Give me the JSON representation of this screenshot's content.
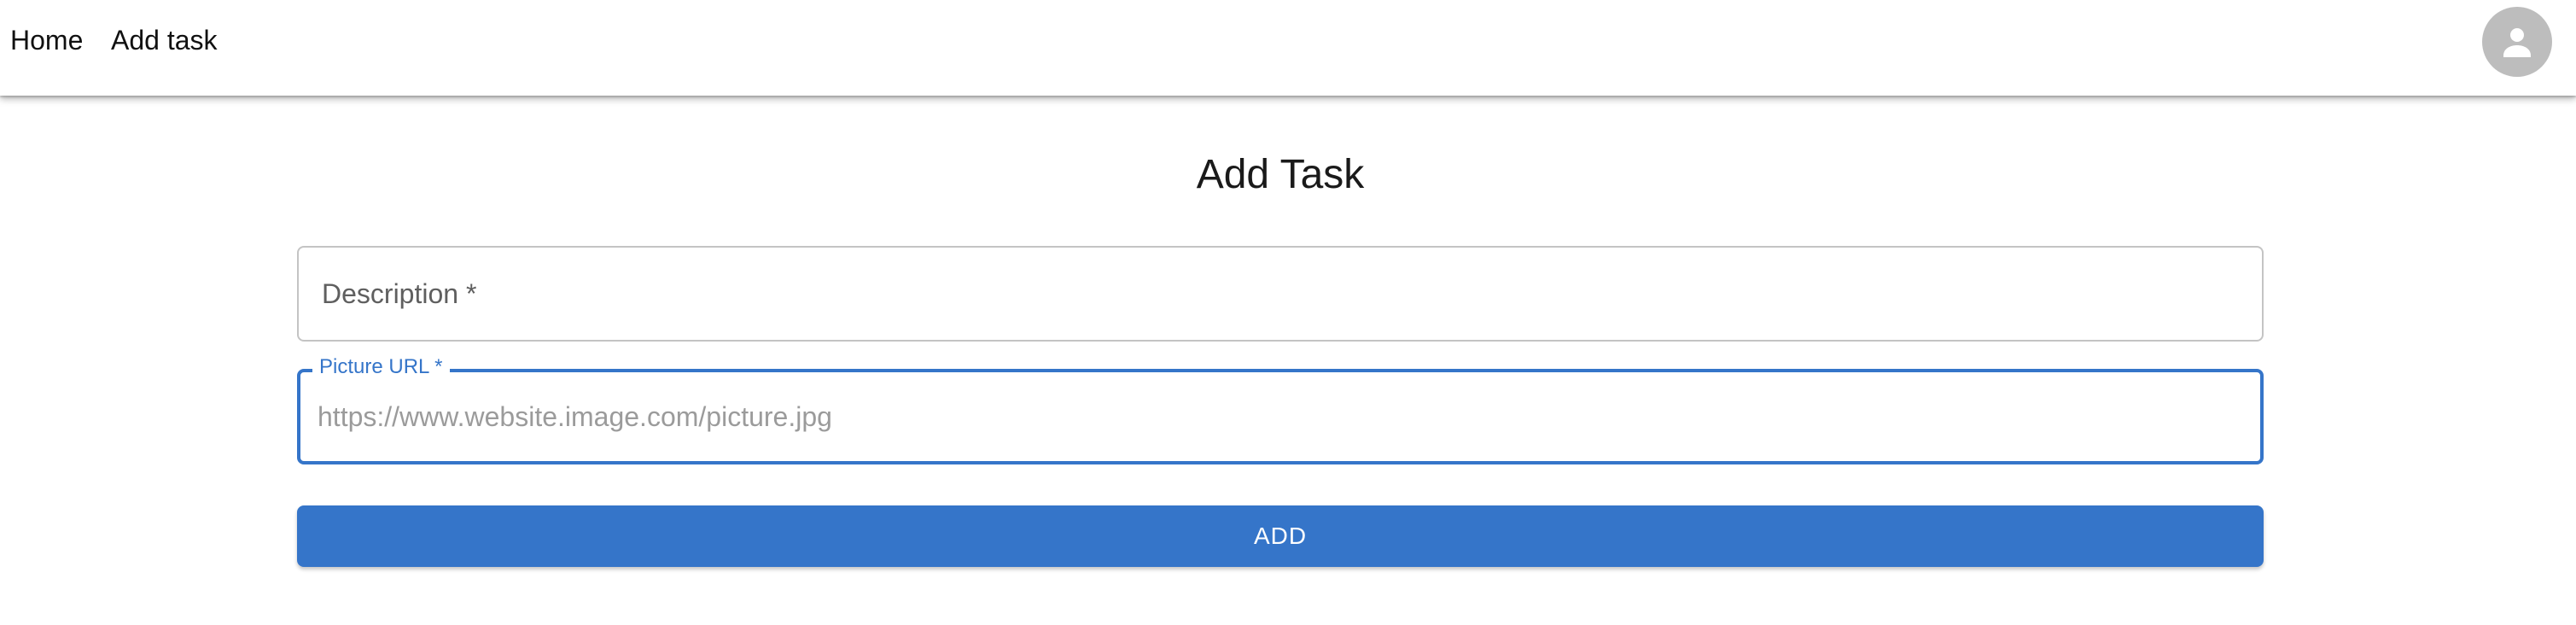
{
  "nav": {
    "home_label": "Home",
    "add_task_label": "Add task",
    "avatar_icon": "person-icon"
  },
  "form": {
    "title": "Add Task",
    "description": {
      "label": "Description *",
      "value": ""
    },
    "picture_url": {
      "label": "Picture URL *",
      "placeholder": "https://www.website.image.com/picture.jpg",
      "value": ""
    },
    "add_label": "ADD"
  },
  "colors": {
    "accent": "#3575c9",
    "avatar_bg": "#bdbdbd",
    "field_border": "#c4c4c4"
  }
}
